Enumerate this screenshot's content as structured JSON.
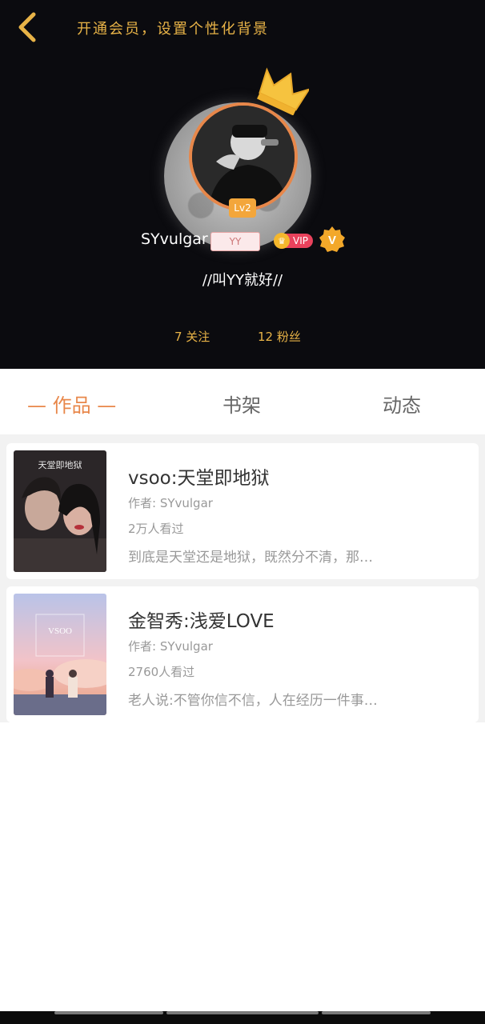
{
  "header": {
    "back_icon": "chevron-left-icon",
    "promo_text": "开通会员，设置个性化背景"
  },
  "profile": {
    "level": "Lv2",
    "username": "SYvulgar",
    "tag": "YY",
    "vip_label": "VIP",
    "vbadge": "V",
    "signature": "//叫YY就好//",
    "following": "7 关注",
    "followers": "12 粉丝"
  },
  "tabs": [
    {
      "label": "— 作品 —",
      "active": true
    },
    {
      "label": "书架",
      "active": false
    },
    {
      "label": "动态",
      "active": false
    }
  ],
  "books": [
    {
      "cover_text": "天堂即地狱",
      "title": "vsoo:天堂即地狱",
      "author": "作者: SYvulgar",
      "views": "2万人看过",
      "desc": "到底是天堂还是地狱，既然分不清，那…"
    },
    {
      "cover_text": "VSOO",
      "title": "金智秀:浅爱LOVE",
      "author": "作者: SYvulgar",
      "views": "2760人看过",
      "desc": "老人说:不管你信不信，人在经历一件事…"
    }
  ],
  "colors": {
    "accent": "#e8874a",
    "gold": "#e8b347",
    "vip_red": "#e9425c",
    "hero_bg": "#0b0b0f"
  }
}
